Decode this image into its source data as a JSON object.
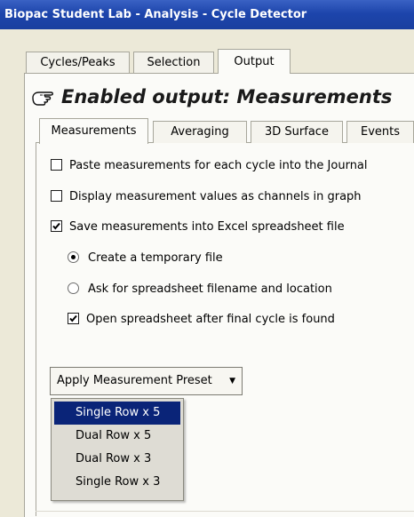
{
  "window": {
    "title": "Biopac Student Lab - Analysis - Cycle Detector"
  },
  "outer_tabs": [
    {
      "label": "Cycles/Peaks"
    },
    {
      "label": "Selection"
    },
    {
      "label": "Output"
    }
  ],
  "heading": {
    "text": "Enabled output: Measurements",
    "icon": "pointing-hand-icon"
  },
  "inner_tabs": [
    {
      "label": "Measurements"
    },
    {
      "label": "Averaging"
    },
    {
      "label": "3D Surface"
    },
    {
      "label": "Events"
    }
  ],
  "options": {
    "paste_journal": {
      "label": "Paste measurements for each cycle into the Journal",
      "checked": false
    },
    "display_channels": {
      "label": "Display measurement values as channels in graph",
      "checked": false
    },
    "save_excel": {
      "label": "Save measurements into Excel spreadsheet file",
      "checked": true
    },
    "temp_file": {
      "label": "Create a temporary file",
      "selected": true
    },
    "ask_filename": {
      "label": "Ask for spreadsheet filename and location",
      "selected": false
    },
    "open_after": {
      "label": "Open spreadsheet after final cycle is found",
      "checked": true
    }
  },
  "preset": {
    "button_label": "Apply Measurement Preset",
    "menu_items": [
      "Single Row x 5",
      "Dual Row x 5",
      "Dual Row x 3",
      "Single Row x 3"
    ],
    "selected_index": 0
  },
  "colors": {
    "titlebar": "#1d45ac",
    "panel": "#fbfbf8",
    "menu_highlight": "#0a2478"
  }
}
